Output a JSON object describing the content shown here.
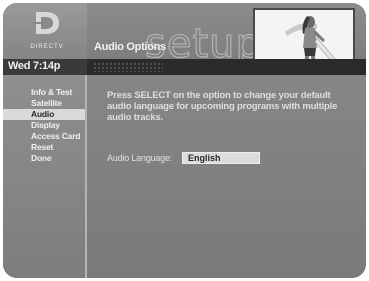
{
  "header": {
    "logo_text": "DIRECTV",
    "clock": "Wed 7:14p",
    "page_title": "Audio Options",
    "decorative_word": "setup"
  },
  "menu": {
    "items": [
      {
        "label": "Info & Test",
        "selected": false
      },
      {
        "label": "Satellite",
        "selected": false
      },
      {
        "label": "Audio",
        "selected": true
      },
      {
        "label": "Display",
        "selected": false
      },
      {
        "label": "Access Card",
        "selected": false
      },
      {
        "label": "Reset",
        "selected": false
      },
      {
        "label": "Done",
        "selected": false
      }
    ]
  },
  "main": {
    "prompt": "Press SELECT on the option to change your default audio language for upcoming programs with multiple audio tracks.",
    "audio_language_label": "Audio Language:",
    "audio_language_value": "English"
  },
  "colors": {
    "background": "#8a8a8a",
    "selected_item": "#d9d9d9",
    "dark_strip": "#2a2a2a"
  }
}
